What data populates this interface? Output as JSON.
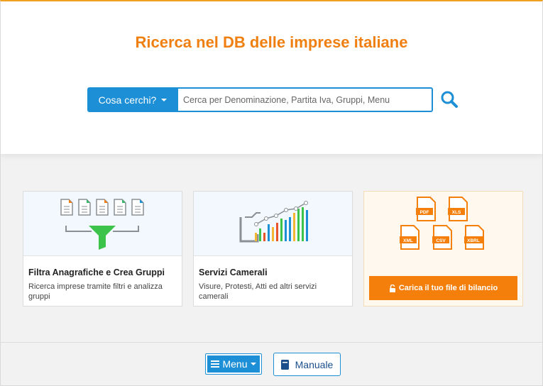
{
  "header": {
    "title": "Ricerca nel DB delle imprese italiane"
  },
  "search": {
    "dropdown_label": "Cosa cerchi?",
    "placeholder": "Cerca per Denominazione, Partita Iva, Gruppi, Menu",
    "value": ""
  },
  "cards": [
    {
      "title": "Filtra Anagrafiche e Crea Gruppi",
      "description": "Ricerca imprese tramite filtri e analizza gruppi",
      "icon": "filter-documents-icon"
    },
    {
      "title": "Servizi Camerali",
      "description": "Visure, Protesti, Atti ed altri servizi camerali",
      "icon": "growth-chart-icon"
    },
    {
      "upload_label": "Carica il tuo file di bilancio",
      "icon": "file-formats-icon",
      "file_types": [
        "PDF",
        "XLS",
        "XML",
        "CSV",
        "XBRL"
      ]
    }
  ],
  "footer": {
    "menu_label": "Menu",
    "manual_label": "Manuale"
  },
  "colors": {
    "accent_orange": "#f07f12",
    "primary_blue": "#1d8fd6",
    "upload_orange": "#f47f0b"
  }
}
